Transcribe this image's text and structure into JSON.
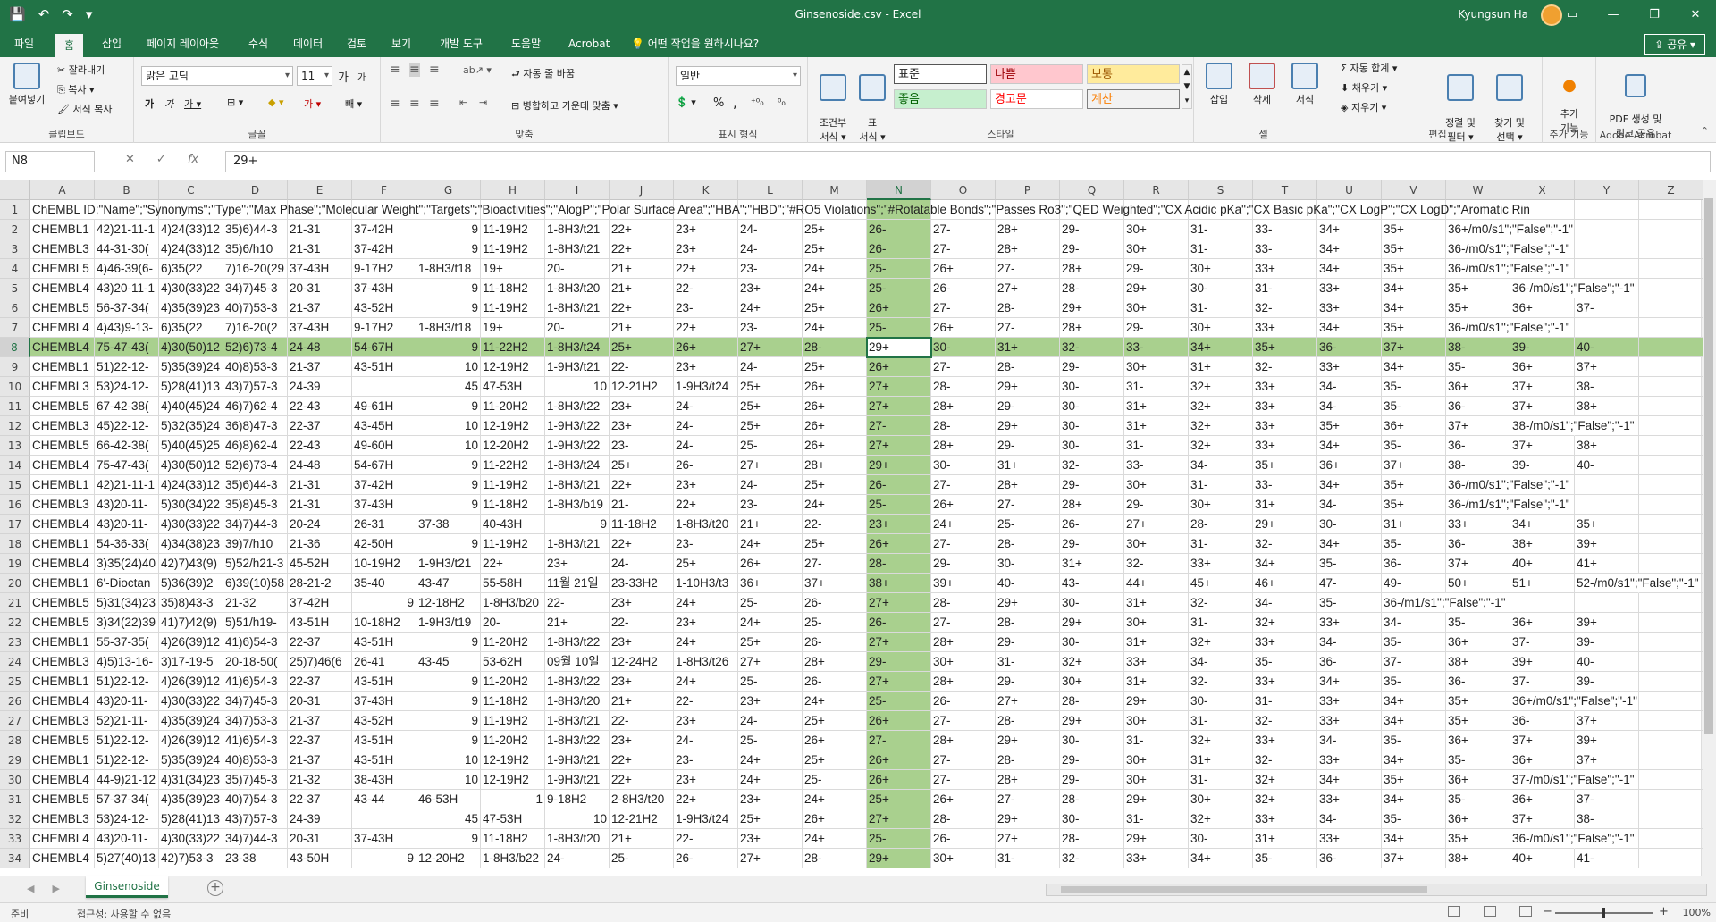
{
  "titlebar": {
    "title": "Ginsenoside.csv  -  Excel",
    "user": "Kyungsun Ha",
    "qat": [
      "💾",
      "↶",
      "↷",
      "▾"
    ],
    "win_buttons": [
      "▭",
      "—",
      "❐",
      "✕"
    ]
  },
  "tabs": [
    "파일",
    "홈",
    "삽입",
    "페이지 레이아웃",
    "수식",
    "데이터",
    "검토",
    "보기",
    "개발 도구",
    "도움말",
    "Acrobat"
  ],
  "tellme": "💡  어떤 작업을 원하시나요?",
  "share": "⇪ 공유 ▾",
  "ribbon": {
    "clipboard": {
      "paste": "붙여넣기",
      "cut": "✂ 잘라내기",
      "copy": "⎘ 복사  ▾",
      "format_painter": "🖌 서식 복사",
      "label": "클립보드"
    },
    "font": {
      "name": "맑은 고딕",
      "size": "11",
      "grow": "가",
      "shrink": "가",
      "bold": "가",
      "italic": "가",
      "underline": "가 ▾",
      "border": "⊞ ▾",
      "fill": "◆ ▾",
      "color": "가 ▾",
      "phonetic": "빼 ▾",
      "label": "글꼴"
    },
    "align": {
      "wrap": "⮐ 자동 줄 바꿈",
      "merge": "⊟ 병합하고 가운데 맞춤  ▾",
      "label": "맞춤"
    },
    "number": {
      "format": "일반",
      "currency": "💲 ▾",
      "percent": "%",
      "comma": ",",
      "inc": "⁺⁰₀",
      "dec": "⁰₀",
      "label": "표시 형식"
    },
    "styles": {
      "cond": "조건부\n서식 ▾",
      "table": "표\n서식 ▾",
      "normal": "표준",
      "bad": "나쁨",
      "neutral": "보통",
      "good": "좋음",
      "warning": "경고문",
      "calc": "계산",
      "label": "스타일"
    },
    "cells": {
      "insert": "삽입",
      "delete": "삭제",
      "format": "서식",
      "label": "셀"
    },
    "editing": {
      "autosum": "Σ 자동 합계  ▾",
      "fill": "⬇ 채우기 ▾",
      "clear": "◈ 지우기 ▾",
      "sort": "정렬 및\n필터 ▾",
      "find": "찾기 및\n선택 ▾",
      "label": "편집"
    },
    "addins": {
      "btn": "추가\n기능",
      "label": "추가 기능"
    },
    "acrobat": {
      "btn": "PDF 생성 및\n링크 공유",
      "label": "Adobe Acrobat"
    }
  },
  "formula_bar": {
    "name_box": "N8",
    "cancel": "✕",
    "enter": "✓",
    "fx": "fx",
    "formula": "29+"
  },
  "sheet": {
    "columns": [
      "A",
      "B",
      "C",
      "D",
      "E",
      "F",
      "G",
      "H",
      "I",
      "J",
      "K",
      "L",
      "M",
      "N",
      "O",
      "P",
      "Q",
      "R",
      "S",
      "T",
      "U",
      "V",
      "W",
      "X",
      "Y",
      "Z"
    ],
    "selected_column": "N",
    "selected_row": "8",
    "header_row": "ChEMBL ID;\"Name\";\"Synonyms\";\"Type\";\"Max Phase\";\"Molecular Weight\";\"Targets\";\"Bioactivities\";\"AlogP\";\"Polar Surface Area\";\"HBA\";\"HBD\";\"#RO5 Violations\";\"#Rotatable Bonds\";\"Passes Ro3\";\"QED Weighted\";\"CX Acidic pKa\";\"CX Basic pKa\";\"CX LogP\";\"CX LogD\";\"Aromatic Rin",
    "rows": [
      [
        "2",
        "CHEMBL1",
        "42)21-11-1",
        "4)24(33)12",
        "35)6)44-3",
        "21-31",
        "37-42H",
        "9",
        "11-19H2",
        "1-8H3/t21",
        "22+",
        "23+",
        "24-",
        "25+",
        "26-",
        "27-",
        "28+",
        "29-",
        "30+",
        "31-",
        "33-",
        "34+",
        "35+",
        "36+/m0/s1\";\"False\";\"-1\"",
        "",
        ""
      ],
      [
        "3",
        "CHEMBL3",
        "44-31-30(",
        "4)24(33)12",
        "35)6/h10",
        "21-31",
        "37-42H",
        "9",
        "11-19H2",
        "1-8H3/t21",
        "22+",
        "23+",
        "24-",
        "25+",
        "26-",
        "27-",
        "28+",
        "29-",
        "30+",
        "31-",
        "33-",
        "34+",
        "35+",
        "36-/m0/s1\";\"False\";\"-1\"",
        "",
        ""
      ],
      [
        "4",
        "CHEMBL5",
        "4)46-39(6-",
        "6)35(22",
        "7)16-20(29",
        "37-43H",
        "9-17H2",
        "1-8H3/t18",
        "19+",
        "20-",
        "21+",
        "22+",
        "23-",
        "24+",
        "25-",
        "26+",
        "27-",
        "28+",
        "29-",
        "30+",
        "33+",
        "34+",
        "35+",
        "36-/m0/s1\";\"False\";\"-1\"",
        "",
        ""
      ],
      [
        "5",
        "CHEMBL4",
        "43)20-11-1",
        "4)30(33)22",
        "34)7)45-3",
        "20-31",
        "37-43H",
        "9",
        "11-18H2",
        "1-8H3/t20",
        "21+",
        "22-",
        "23+",
        "24+",
        "25-",
        "26-",
        "27+",
        "28-",
        "29+",
        "30-",
        "31-",
        "33+",
        "34+",
        "35+",
        "36-/m0/s1\";\"False\";\"-1\"",
        ""
      ],
      [
        "6",
        "CHEMBL5",
        "56-37-34(",
        "4)35(39)23",
        "40)7)53-3",
        "21-37",
        "43-52H",
        "9",
        "11-19H2",
        "1-8H3/t21",
        "22+",
        "23-",
        "24+",
        "25+",
        "26+",
        "27-",
        "28-",
        "29+",
        "30+",
        "31-",
        "32-",
        "33+",
        "34+",
        "35+",
        "36+",
        "37-"
      ],
      [
        "7",
        "CHEMBL4",
        "4)43)9-13-",
        "6)35(22",
        "7)16-20(2",
        "37-43H",
        "9-17H2",
        "1-8H3/t18",
        "19+",
        "20-",
        "21+",
        "22+",
        "23-",
        "24+",
        "25-",
        "26+",
        "27-",
        "28+",
        "29-",
        "30+",
        "33+",
        "34+",
        "35+",
        "36-/m0/s1\";\"False\";\"-1\"",
        "",
        ""
      ],
      [
        "8",
        "CHEMBL4",
        "75-47-43(",
        "4)30(50)12",
        "52)6)73-4",
        "24-48",
        "54-67H",
        "9",
        "11-22H2",
        "1-8H3/t24",
        "25+",
        "26+",
        "27+",
        "28-",
        "29+",
        "30-",
        "31+",
        "32-",
        "33-",
        "34+",
        "35+",
        "36-",
        "37+",
        "38-",
        "39-",
        "40-"
      ],
      [
        "9",
        "CHEMBL1",
        "51)22-12-",
        "5)35(39)24",
        "40)8)53-3",
        "21-37",
        "43-51H",
        "10",
        "12-19H2",
        "1-9H3/t21",
        "22-",
        "23+",
        "24-",
        "25+",
        "26+",
        "27-",
        "28-",
        "29-",
        "30+",
        "31+",
        "32-",
        "33+",
        "34+",
        "35-",
        "36+",
        "37+"
      ],
      [
        "10",
        "CHEMBL3",
        "53)24-12-",
        "5)28(41)13",
        "43)7)57-3",
        "24-39",
        "",
        "45",
        "47-53H",
        "10",
        "12-21H2",
        "1-9H3/t24",
        "25+",
        "26+",
        "27+",
        "28-",
        "29+",
        "30-",
        "31-",
        "32+",
        "33+",
        "34-",
        "35-",
        "36+",
        "37+",
        "38-"
      ],
      [
        "11",
        "CHEMBL5",
        "67-42-38(",
        "4)40(45)24",
        "46)7)62-4",
        "22-43",
        "49-61H",
        "9",
        "11-20H2",
        "1-8H3/t22",
        "23+",
        "24-",
        "25+",
        "26+",
        "27+",
        "28+",
        "29-",
        "30-",
        "31+",
        "32+",
        "33+",
        "34-",
        "35-",
        "36-",
        "37+",
        "38+"
      ],
      [
        "12",
        "CHEMBL3",
        "45)22-12-",
        "5)32(35)24",
        "36)8)47-3",
        "22-37",
        "43-45H",
        "10",
        "12-19H2",
        "1-9H3/t22",
        "23+",
        "24-",
        "25+",
        "26+",
        "27-",
        "28-",
        "29+",
        "30-",
        "31+",
        "32+",
        "33+",
        "35+",
        "36+",
        "37+",
        "38-/m0/s1\";\"False\";\"-1\"",
        ""
      ],
      [
        "13",
        "CHEMBL5",
        "66-42-38(",
        "5)40(45)25",
        "46)8)62-4",
        "22-43",
        "49-60H",
        "10",
        "12-20H2",
        "1-9H3/t22",
        "23-",
        "24-",
        "25-",
        "26+",
        "27+",
        "28+",
        "29-",
        "30-",
        "31-",
        "32+",
        "33+",
        "34+",
        "35-",
        "36-",
        "37+",
        "38+"
      ],
      [
        "14",
        "CHEMBL4",
        "75-47-43(",
        "4)30(50)12",
        "52)6)73-4",
        "24-48",
        "54-67H",
        "9",
        "11-22H2",
        "1-8H3/t24",
        "25+",
        "26-",
        "27+",
        "28+",
        "29+",
        "30-",
        "31+",
        "32-",
        "33-",
        "34-",
        "35+",
        "36+",
        "37+",
        "38-",
        "39-",
        "40-"
      ],
      [
        "15",
        "CHEMBL1",
        "42)21-11-1",
        "4)24(33)12",
        "35)6)44-3",
        "21-31",
        "37-42H",
        "9",
        "11-19H2",
        "1-8H3/t21",
        "22+",
        "23+",
        "24-",
        "25+",
        "26-",
        "27-",
        "28+",
        "29-",
        "30+",
        "31-",
        "33-",
        "34+",
        "35+",
        "36-/m0/s1\";\"False\";\"-1\"",
        "",
        ""
      ],
      [
        "16",
        "CHEMBL3",
        "43)20-11-",
        "5)30(34)22",
        "35)8)45-3",
        "21-31",
        "37-43H",
        "9",
        "11-18H2",
        "1-8H3/b19",
        "21-",
        "22+",
        "23-",
        "24+",
        "25-",
        "26+",
        "27-",
        "28+",
        "29-",
        "30+",
        "31+",
        "34-",
        "35+",
        "36-/m1/s1\";\"False\";\"-1\"",
        "",
        ""
      ],
      [
        "17",
        "CHEMBL4",
        "43)20-11-",
        "4)30(33)22",
        "34)7)44-3",
        "20-24",
        "26-31",
        "37-38",
        "40-43H",
        "9",
        "11-18H2",
        "1-8H3/t20",
        "21+",
        "22-",
        "23+",
        "24+",
        "25-",
        "26-",
        "27+",
        "28-",
        "29+",
        "30-",
        "31+",
        "33+",
        "34+",
        "35+"
      ],
      [
        "18",
        "CHEMBL1",
        "54-36-33(",
        "4)34(38)23",
        "39)7/h10",
        "21-36",
        "42-50H",
        "9",
        "11-19H2",
        "1-8H3/t21",
        "22+",
        "23-",
        "24+",
        "25+",
        "26+",
        "27-",
        "28-",
        "29-",
        "30+",
        "31-",
        "32-",
        "34+",
        "35-",
        "36-",
        "38+",
        "39+"
      ],
      [
        "19",
        "CHEMBL4",
        "3)35(24)40",
        "42)7)43(9)",
        "5)52/h21-3",
        "45-52H",
        "10-19H2",
        "1-9H3/t21",
        "22+",
        "23+",
        "24-",
        "25+",
        "26+",
        "27-",
        "28-",
        "29-",
        "30-",
        "31+",
        "32-",
        "33+",
        "34+",
        "35-",
        "36-",
        "37+",
        "40+",
        "41+"
      ],
      [
        "20",
        "CHEMBL1",
        "6'-Dioctan",
        "5)36(39)2",
        "6)39(10)58",
        "28-21-2",
        "35-40",
        "43-47",
        "55-58H",
        "11월 21일",
        "23-33H2",
        "1-10H3/t3",
        "36+",
        "37+",
        "38+",
        "39+",
        "40-",
        "43-",
        "44+",
        "45+",
        "46+",
        "47-",
        "49-",
        "50+",
        "51+",
        "52-/m0/s1\";\"False\";\"-1\""
      ],
      [
        "21",
        "CHEMBL5",
        "5)31(34)23",
        "35)8)43-3",
        "21-32",
        "37-42H",
        "9",
        "12-18H2",
        "1-8H3/b20",
        "22-",
        "23+",
        "24+",
        "25-",
        "26-",
        "27+",
        "28-",
        "29+",
        "30-",
        "31+",
        "32-",
        "34-",
        "35-",
        "36-/m1/s1\";\"False\";\"-1\"",
        "",
        ""
      ],
      [
        "22",
        "CHEMBL5",
        "3)34(22)39",
        "41)7)42(9)",
        "5)51/h19-",
        "43-51H",
        "10-18H2",
        "1-9H3/t19",
        "20-",
        "21+",
        "22-",
        "23+",
        "24+",
        "25-",
        "26-",
        "27-",
        "28-",
        "29+",
        "30+",
        "31-",
        "32+",
        "33+",
        "34-",
        "35-",
        "36+",
        "39+"
      ],
      [
        "23",
        "CHEMBL1",
        "55-37-35(",
        "4)26(39)12",
        "41)6)54-3",
        "22-37",
        "43-51H",
        "9",
        "11-20H2",
        "1-8H3/t22",
        "23+",
        "24+",
        "25+",
        "26-",
        "27+",
        "28+",
        "29-",
        "30-",
        "31+",
        "32+",
        "33+",
        "34-",
        "35-",
        "36+",
        "37-",
        "39-"
      ],
      [
        "24",
        "CHEMBL3",
        "4)5)13-16-",
        "3)17-19-5",
        "20-18-50(",
        "25)7)46(6",
        "26-41",
        "43-45",
        "53-62H",
        "09월 10일",
        "12-24H2",
        "1-8H3/t26",
        "27+",
        "28+",
        "29-",
        "30+",
        "31-",
        "32+",
        "33+",
        "34-",
        "35-",
        "36-",
        "37-",
        "38+",
        "39+",
        "40-"
      ],
      [
        "25",
        "CHEMBL1",
        "51)22-12-",
        "4)26(39)12",
        "41)6)54-3",
        "22-37",
        "43-51H",
        "9",
        "11-20H2",
        "1-8H3/t22",
        "23+",
        "24+",
        "25-",
        "26-",
        "27+",
        "28+",
        "29-",
        "30+",
        "31+",
        "32-",
        "33+",
        "34+",
        "35-",
        "36-",
        "37-",
        "39-"
      ],
      [
        "26",
        "CHEMBL4",
        "43)20-11-",
        "4)30(33)22",
        "34)7)45-3",
        "20-31",
        "37-43H",
        "9",
        "11-18H2",
        "1-8H3/t20",
        "21+",
        "22-",
        "23+",
        "24+",
        "25-",
        "26-",
        "27+",
        "28-",
        "29+",
        "30-",
        "31-",
        "33+",
        "34+",
        "35+",
        "36+/m0/s1\";\"False\";\"-1\"",
        ""
      ],
      [
        "27",
        "CHEMBL3",
        "52)21-11-",
        "4)35(39)24",
        "34)7)53-3",
        "21-37",
        "43-52H",
        "9",
        "11-19H2",
        "1-8H3/t21",
        "22-",
        "23+",
        "24-",
        "25+",
        "26+",
        "27-",
        "28-",
        "29+",
        "30+",
        "31-",
        "32-",
        "33+",
        "34+",
        "35+",
        "36-",
        "37+"
      ],
      [
        "28",
        "CHEMBL5",
        "51)22-12-",
        "4)26(39)12",
        "41)6)54-3",
        "22-37",
        "43-51H",
        "9",
        "11-20H2",
        "1-8H3/t22",
        "23+",
        "24-",
        "25-",
        "26+",
        "27-",
        "28+",
        "29+",
        "30-",
        "31-",
        "32+",
        "33+",
        "34-",
        "35-",
        "36+",
        "37+",
        "39+"
      ],
      [
        "29",
        "CHEMBL1",
        "51)22-12-",
        "5)35(39)24",
        "40)8)53-3",
        "21-37",
        "43-51H",
        "10",
        "12-19H2",
        "1-9H3/t21",
        "22+",
        "23-",
        "24+",
        "25+",
        "26+",
        "27-",
        "28-",
        "29-",
        "30+",
        "31+",
        "32-",
        "33+",
        "34+",
        "35-",
        "36+",
        "37+"
      ],
      [
        "30",
        "CHEMBL4",
        "44-9)21-12",
        "4)31(34)23",
        "35)7)45-3",
        "21-32",
        "38-43H",
        "10",
        "12-19H2",
        "1-9H3/t21",
        "22+",
        "23+",
        "24+",
        "25-",
        "26+",
        "27-",
        "28+",
        "29-",
        "30+",
        "31-",
        "32+",
        "34+",
        "35+",
        "36+",
        "37-/m0/s1\";\"False\";\"-1\"",
        ""
      ],
      [
        "31",
        "CHEMBL5",
        "57-37-34(",
        "4)35(39)23",
        "40)7)54-3",
        "22-37",
        "43-44",
        "46-53H",
        "1",
        "9-18H2",
        "2-8H3/t20",
        "22+",
        "23+",
        "24+",
        "25+",
        "26+",
        "27-",
        "28-",
        "29+",
        "30+",
        "32+",
        "33+",
        "34+",
        "35-",
        "36+",
        "37-"
      ],
      [
        "32",
        "CHEMBL3",
        "53)24-12-",
        "5)28(41)13",
        "43)7)57-3",
        "24-39",
        "",
        "45",
        "47-53H",
        "10",
        "12-21H2",
        "1-9H3/t24",
        "25+",
        "26+",
        "27+",
        "28-",
        "29+",
        "30-",
        "31-",
        "32+",
        "33+",
        "34-",
        "35-",
        "36+",
        "37+",
        "38-"
      ],
      [
        "33",
        "CHEMBL4",
        "43)20-11-",
        "4)30(33)22",
        "34)7)44-3",
        "20-31",
        "37-43H",
        "9",
        "11-18H2",
        "1-8H3/t20",
        "21+",
        "22-",
        "23+",
        "24+",
        "25-",
        "26-",
        "27+",
        "28-",
        "29+",
        "30-",
        "31+",
        "33+",
        "34+",
        "35+",
        "36-/m0/s1\";\"False\";\"-1\"",
        ""
      ],
      [
        "34",
        "CHEMBL4",
        "5)27(40)13",
        "42)7)53-3",
        "23-38",
        "43-50H",
        "9",
        "12-20H2",
        "1-8H3/b22",
        "24-",
        "25-",
        "26-",
        "27+",
        "28-",
        "29+",
        "30+",
        "31-",
        "32-",
        "33+",
        "34+",
        "35-",
        "36-",
        "37+",
        "38+",
        "40+",
        "41-"
      ]
    ]
  },
  "sheet_tab": "Ginsenoside",
  "status": {
    "ready": "준비",
    "accessibility": "접근성: 사용할 수 없음",
    "zoom": "100%"
  }
}
